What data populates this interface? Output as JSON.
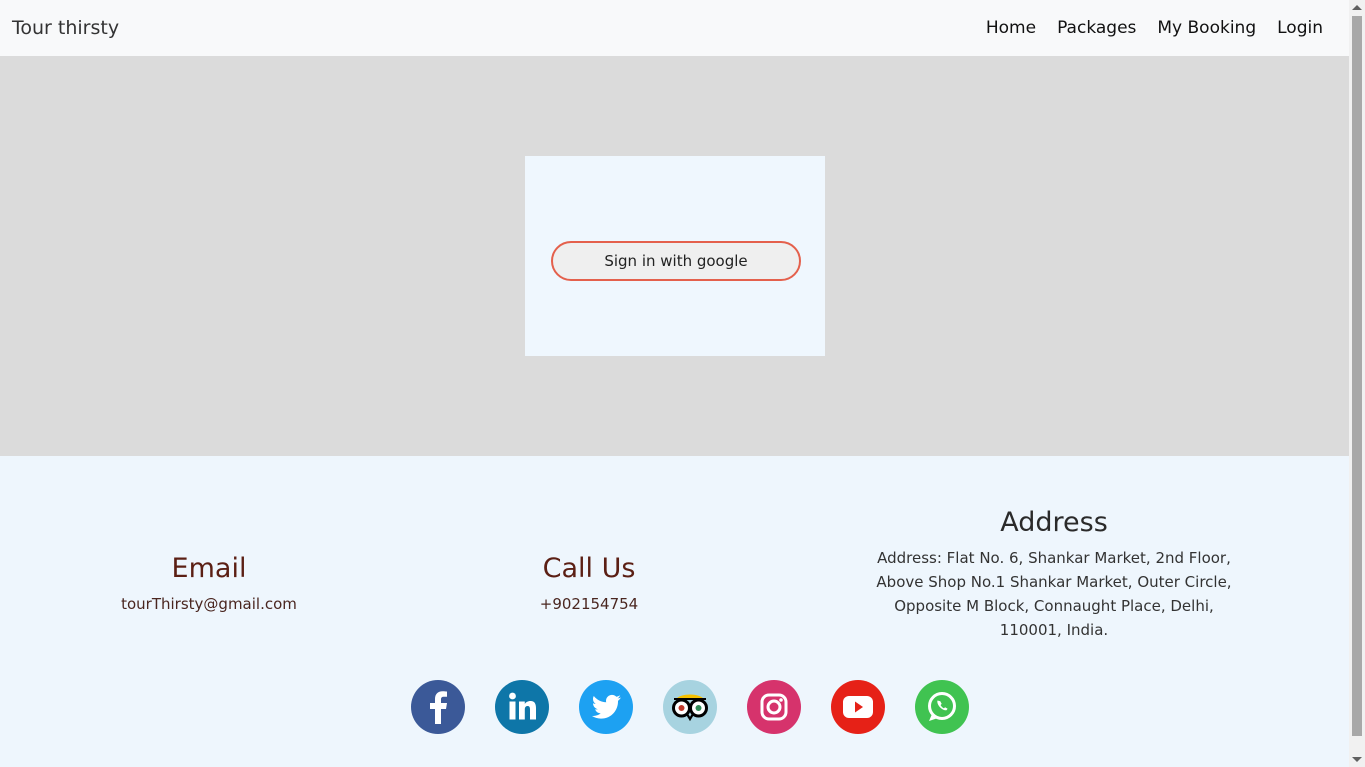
{
  "navbar": {
    "brand": "Tour thirsty",
    "links": [
      "Home",
      "Packages",
      "My Booking",
      "Login"
    ]
  },
  "login": {
    "google_button_label": "Sign in with google"
  },
  "footer": {
    "email": {
      "heading": "Email",
      "value": "tourThirsty@gmail.com"
    },
    "call": {
      "heading": "Call Us",
      "value": "+902154754"
    },
    "address": {
      "heading": "Address",
      "lines": [
        "Address: Flat No. 6, Shankar Market, 2nd Floor,",
        "Above Shop No.1 Shankar Market, Outer Circle,",
        "Opposite M Block, Connaught Place, Delhi,",
        "110001, India."
      ]
    },
    "socials": [
      {
        "icon": "facebook-icon",
        "color": "#3b5998"
      },
      {
        "icon": "linkedin-icon",
        "color": "#0e76a8"
      },
      {
        "icon": "twitter-icon",
        "color": "#1da1f2"
      },
      {
        "icon": "tripadvisor-icon",
        "color": "#a7d3e0"
      },
      {
        "icon": "instagram-icon",
        "color": "#d6336c"
      },
      {
        "icon": "youtube-icon",
        "color": "#e62117"
      },
      {
        "icon": "whatsapp-icon",
        "color": "#40c351"
      }
    ]
  }
}
